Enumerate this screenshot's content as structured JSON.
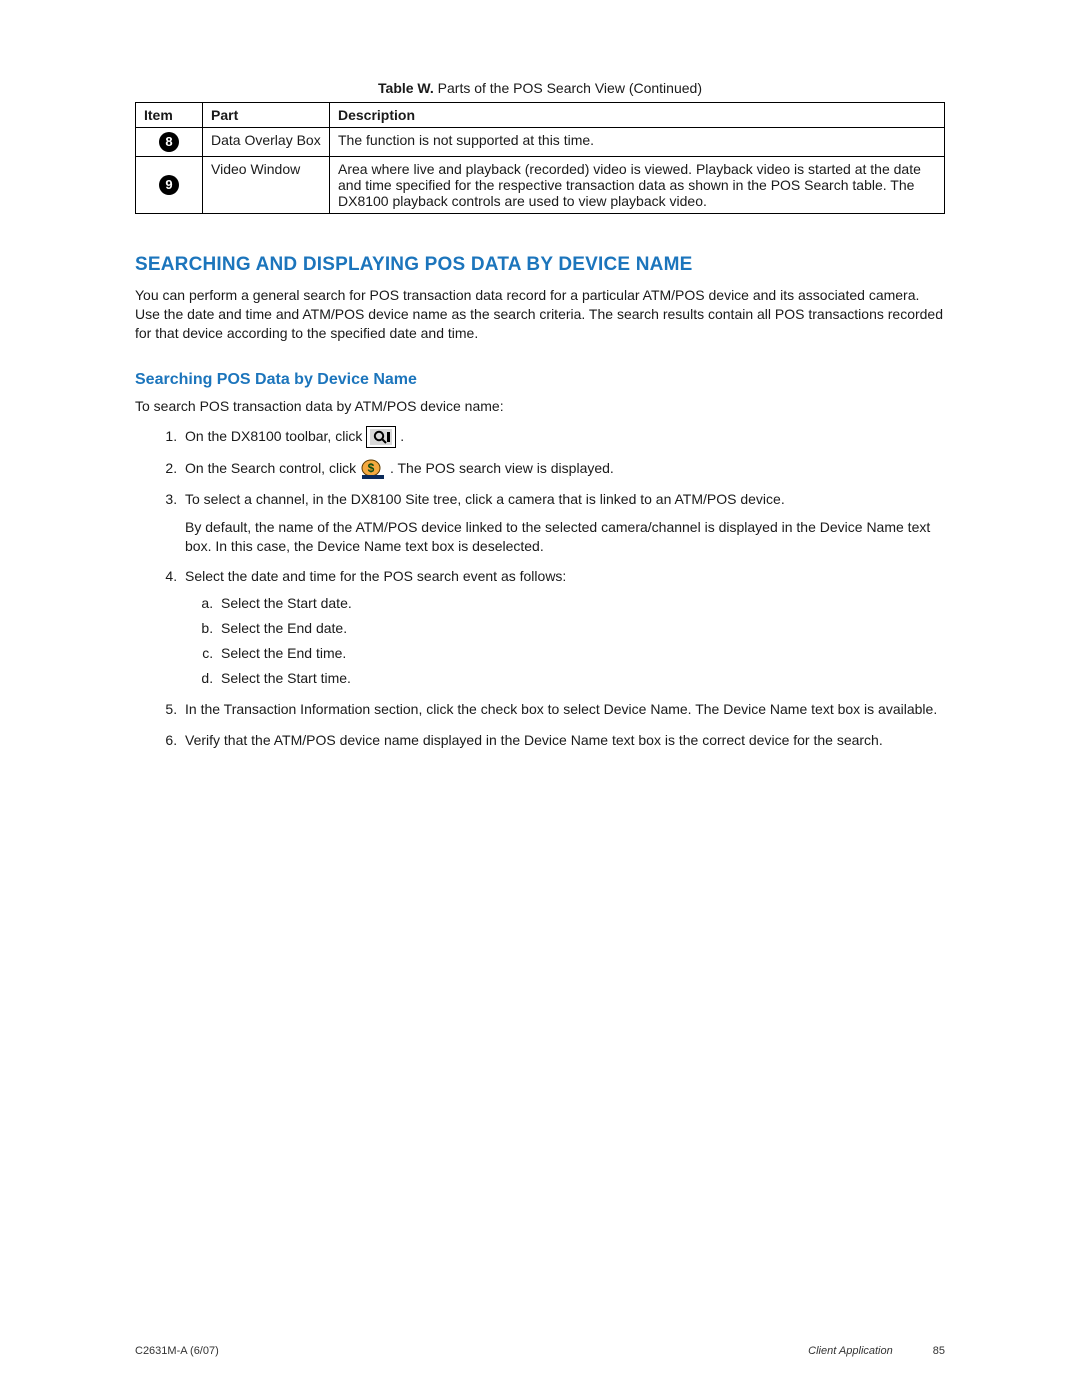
{
  "table": {
    "caption_prefix": "Table W.",
    "caption_text": "Parts of the POS Search View (Continued)",
    "headers": {
      "item": "Item",
      "part": "Part",
      "description": "Description"
    },
    "rows": [
      {
        "item": "8",
        "part": "Data Overlay Box",
        "description": "The function is not supported at this time."
      },
      {
        "item": "9",
        "part": "Video Window",
        "description": "Area where live and playback (recorded) video is viewed. Playback video is started at the date and time specified for the respective transaction data as shown in the POS Search table. The DX8100 playback controls are used to view playback video."
      }
    ]
  },
  "heading1": "SEARCHING AND DISPLAYING POS DATA BY DEVICE NAME",
  "intro_para": "You can perform a general search for POS transaction data record for a particular ATM/POS device and its associated camera. Use the date and time and ATM/POS device name as the search criteria. The search results contain all POS transactions recorded for that device according to the specified date and time.",
  "heading2": "Searching POS Data by Device Name",
  "steps_intro": "To search POS transaction data by ATM/POS device name:",
  "steps": {
    "s1_a": "On the DX8100 toolbar, click ",
    "s1_b": ".",
    "s2_a": "On the Search control, click ",
    "s2_b": ". The POS search view is displayed.",
    "s3_a": "To select a channel, in the DX8100 Site tree, click a camera that is linked to an ATM/POS device.",
    "s3_b": "By default, the name of the ATM/POS device linked to the selected camera/channel is displayed in the Device Name text box. In this case, the Device Name text box is deselected.",
    "s4": "Select the date and time for the POS search event as follows:",
    "sub": {
      "a": "Select the Start date.",
      "b": "Select the End date.",
      "c": "Select the End time.",
      "d": "Select the Start time."
    },
    "s5": "In the Transaction Information section, click the check box to select Device Name. The Device Name text box is available.",
    "s6": "Verify that the ATM/POS device name displayed in the Device Name text box is the correct device for the search."
  },
  "footer": {
    "left": "C2631M-A (6/07)",
    "section": "Client Application",
    "page": "85"
  }
}
